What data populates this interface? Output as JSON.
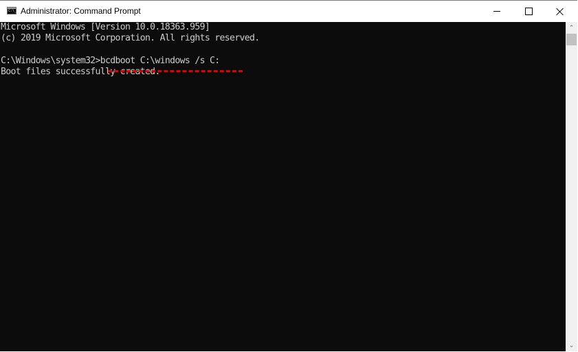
{
  "window": {
    "title": "Administrator: Command Prompt",
    "icon": "cmd-icon",
    "icon_label": "C:\\_",
    "controls": {
      "minimize": "minimize-icon",
      "maximize": "maximize-icon",
      "close": "close-icon"
    }
  },
  "console": {
    "lines": [
      "Microsoft Windows [Version 10.0.18363.959]",
      "(c) 2019 Microsoft Corporation. All rights reserved.",
      "",
      "C:\\Windows\\system32>bcdboot C:\\windows /s C:",
      "Boot files successfully created."
    ],
    "annotation": {
      "type": "dashed-underline",
      "target": "bcdboot C:\\windows /s C:",
      "color": "#e00000"
    },
    "text_color": "#cccccc",
    "background": "#0c0c0c"
  },
  "scrollbar": {
    "up_arrow": "chevron-up-icon",
    "down_arrow": "chevron-down-icon",
    "up_glyph": "⌃",
    "down_glyph": "⌄"
  }
}
